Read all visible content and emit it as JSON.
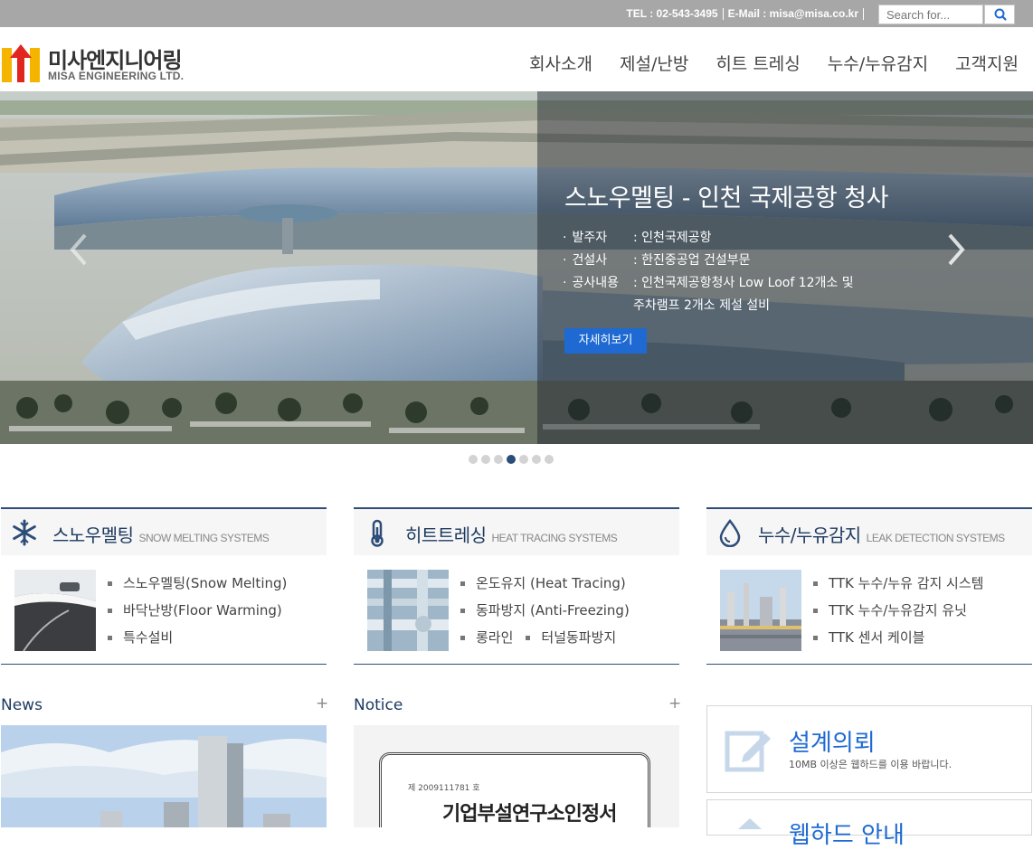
{
  "topbar": {
    "tel": "TEL : 02-543-3495",
    "email": "E-Mail : misa@misa.co.kr",
    "search_placeholder": "Search for..."
  },
  "logo": {
    "name_ko": "미사엔지니어링",
    "name_en": "MISA ENGINEERING LTD."
  },
  "nav": [
    "회사소개",
    "제설/난방",
    "히트 트레싱",
    "누수/누유감지",
    "고객지원"
  ],
  "hero": {
    "title": "스노우멜팅 - 인천 국제공항 청사",
    "info": [
      {
        "key": "발주자",
        "value": ": 인천국제공항"
      },
      {
        "key": "건설사",
        "value": ": 한진중공업 건설부문"
      },
      {
        "key": "공사내용",
        "value": ": 인천국제공항청사 Low Loof 12개소 및"
      },
      {
        "key": "",
        "value": "주차램프 2개소 제설 설비"
      }
    ],
    "button": "자세히보기",
    "slide_count": 7,
    "active_slide": 4
  },
  "categories": [
    {
      "title": "스노우멜팅",
      "subtitle": "SNOW MELTING SYSTEMS",
      "icon": "snowflake-icon",
      "items": [
        "스노우멜팅(Snow Melting)",
        "바닥난방(Floor Warming)",
        "특수설비"
      ]
    },
    {
      "title": "히트트레싱",
      "subtitle": "HEAT TRACING SYSTEMS",
      "icon": "thermometer-icon",
      "items": [
        "온도유지 (Heat Tracing)",
        "동파방지 (Anti-Freezing)",
        "롱라인",
        "터널동파방지"
      ]
    },
    {
      "title": "누수/누유감지",
      "subtitle": "LEAK DETECTION SYSTEMS",
      "icon": "water-drop-icon",
      "items": [
        "TTK 누수/누유 감지 시스템",
        "TTK 누수/누유감지 유닛",
        "TTK 센서 케이블"
      ]
    }
  ],
  "news": {
    "title": "News",
    "more": "+"
  },
  "notice": {
    "title": "Notice",
    "more": "+",
    "doc_number": "제 2009111781 호",
    "doc_title": "기업부설연구소인정서"
  },
  "side": [
    {
      "title": "설계의뢰",
      "desc": "10MB 이상은 웹하드를 이용 바랍니다.",
      "icon": "edit-icon"
    },
    {
      "title": "웹하드 안내",
      "icon": "upload-icon"
    }
  ],
  "colors": {
    "accent": "#1e6ad2",
    "navy": "#2d4d78",
    "topbar": "#a7a7a7"
  }
}
